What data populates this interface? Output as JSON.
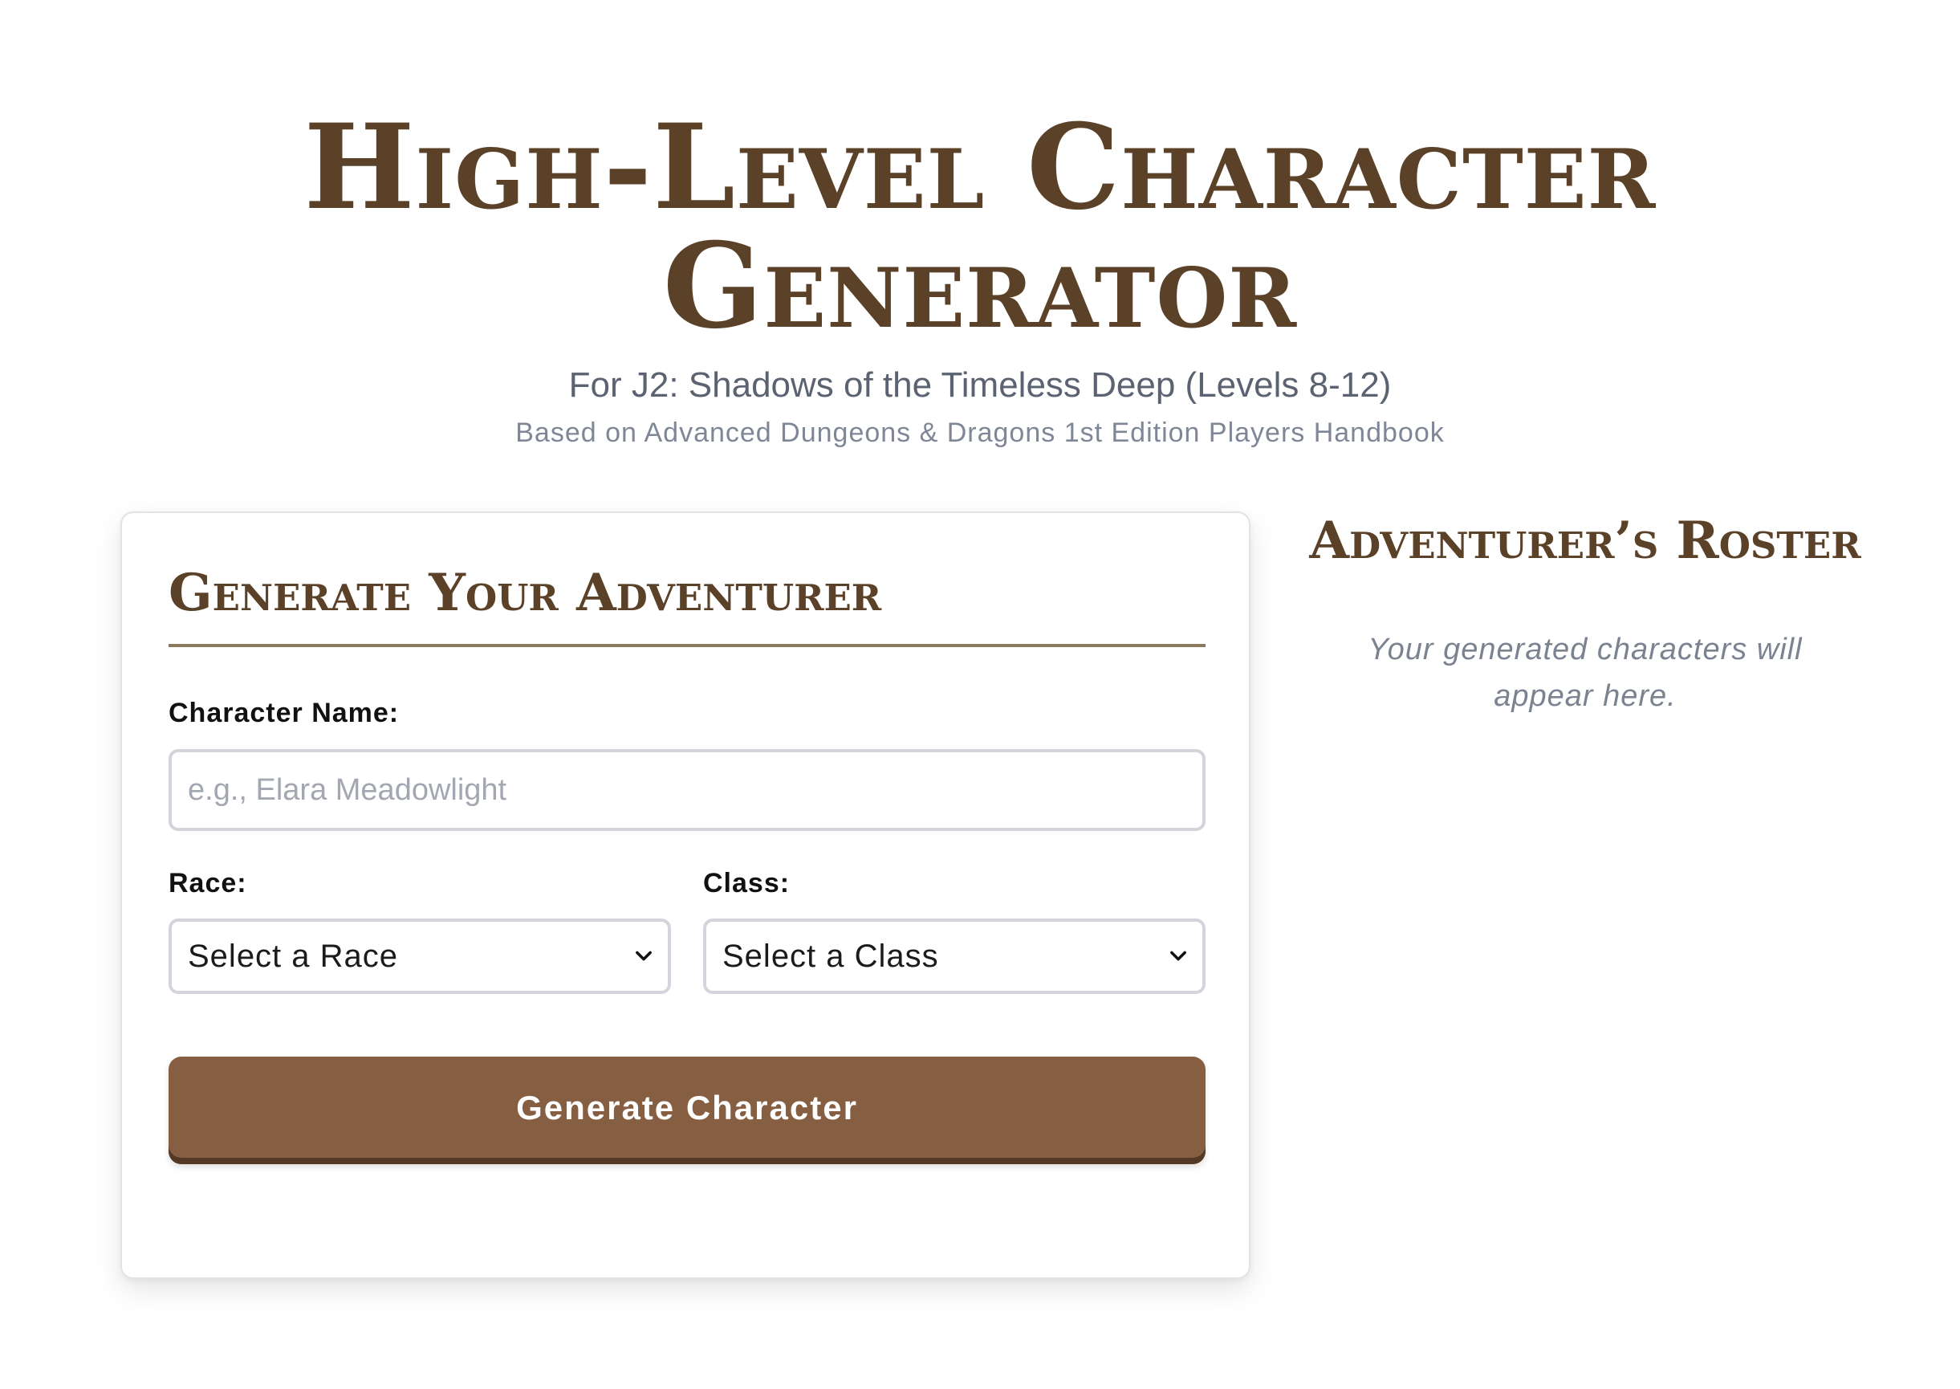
{
  "header": {
    "title": "High-Level Character Generator",
    "subtitle": "For J2: Shadows of the Timeless Deep (Levels 8-12)",
    "source_note": "Based on Advanced Dungeons & Dragons 1st Edition Players Handbook"
  },
  "generator": {
    "title": "Generate Your Adventurer",
    "name_label": "Character Name:",
    "name_value": "",
    "name_placeholder": "e.g., Elara Meadowlight",
    "race_label": "Race:",
    "race_selected": "Select a Race",
    "class_label": "Class:",
    "class_selected": "Select a Class",
    "submit_label": "Generate Character"
  },
  "roster": {
    "title": "Adventurer’s Roster",
    "empty_message": "Your generated characters will appear here."
  },
  "colors": {
    "accent_brown": "#5a4128",
    "button_brown": "#865e41",
    "muted_text": "#5b6373"
  },
  "icons": {
    "select_arrow": "chevron-down-icon"
  }
}
